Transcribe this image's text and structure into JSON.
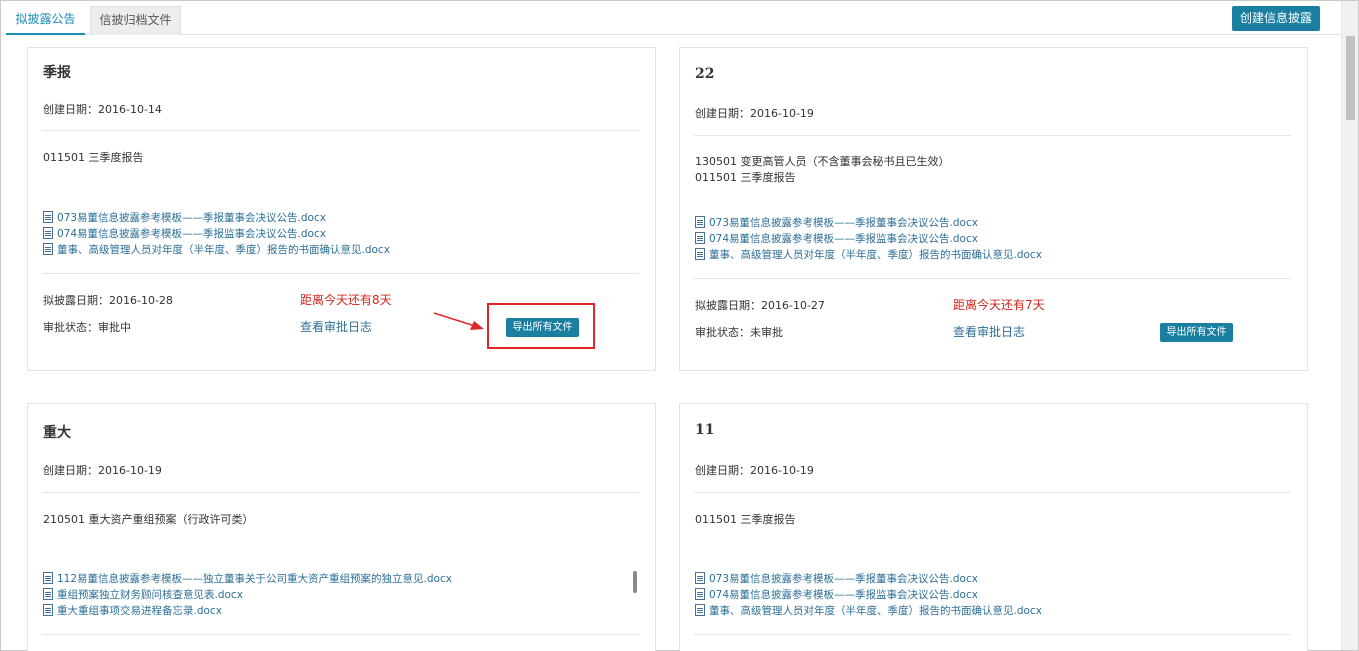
{
  "tabs": [
    {
      "label": "拟披露公告",
      "active": true
    },
    {
      "label": "信披归档文件",
      "active": false
    }
  ],
  "header": {
    "create_label": "创建信息披露"
  },
  "cards": [
    {
      "title": "季报",
      "created": "创建日期：2016-10-14",
      "items": [
        "011501 三季度报告"
      ],
      "files": [
        "073易董信息披露参考模板——季报董事会决议公告.docx",
        "074易董信息披露参考模板——季报监事会决议公告.docx",
        "董事、高级管理人员对年度（半年度、季度）报告的书面确认意见.docx"
      ],
      "disclose_date": "拟披露日期：2016-10-28",
      "countdown": "距离今天还有8天",
      "approval": "审批状态：审批中",
      "log_link": "查看审批日志",
      "export_label": "导出所有文件"
    },
    {
      "title": "22",
      "created": "创建日期：2016-10-19",
      "items": [
        "130501 变更高管人员（不含董事会秘书且已生效）",
        "011501 三季度报告"
      ],
      "files": [
        "073易董信息披露参考模板——季报董事会决议公告.docx",
        "074易董信息披露参考模板——季报监事会决议公告.docx",
        "董事、高级管理人员对年度（半年度、季度）报告的书面确认意见.docx"
      ],
      "disclose_date": "拟披露日期：2016-10-27",
      "countdown": "距离今天还有7天",
      "approval": "审批状态：未审批",
      "log_link": "查看审批日志",
      "export_label": "导出所有文件"
    },
    {
      "title": "重大",
      "created": "创建日期：2016-10-19",
      "items": [
        "210501 重大资产重组预案（行政许可类）"
      ],
      "files": [
        "112易董信息披露参考模板——独立董事关于公司重大资产重组预案的独立意见.docx",
        "重组预案独立财务顾问核查意见表.docx",
        "重大重组事项交易进程备忘录.docx"
      ]
    },
    {
      "title": "11",
      "created": "创建日期：2016-10-19",
      "items": [
        "011501 三季度报告"
      ],
      "files": [
        "073易董信息披露参考模板——季报董事会决议公告.docx",
        "074易董信息披露参考模板——季报监事会决议公告.docx",
        "董事、高级管理人员对年度（半年度、季度）报告的书面确认意见.docx"
      ]
    }
  ],
  "colors": {
    "accent": "#1a7fa1",
    "link": "#2d6f97",
    "warning": "#d0261d",
    "highlight": "#e3262a"
  }
}
